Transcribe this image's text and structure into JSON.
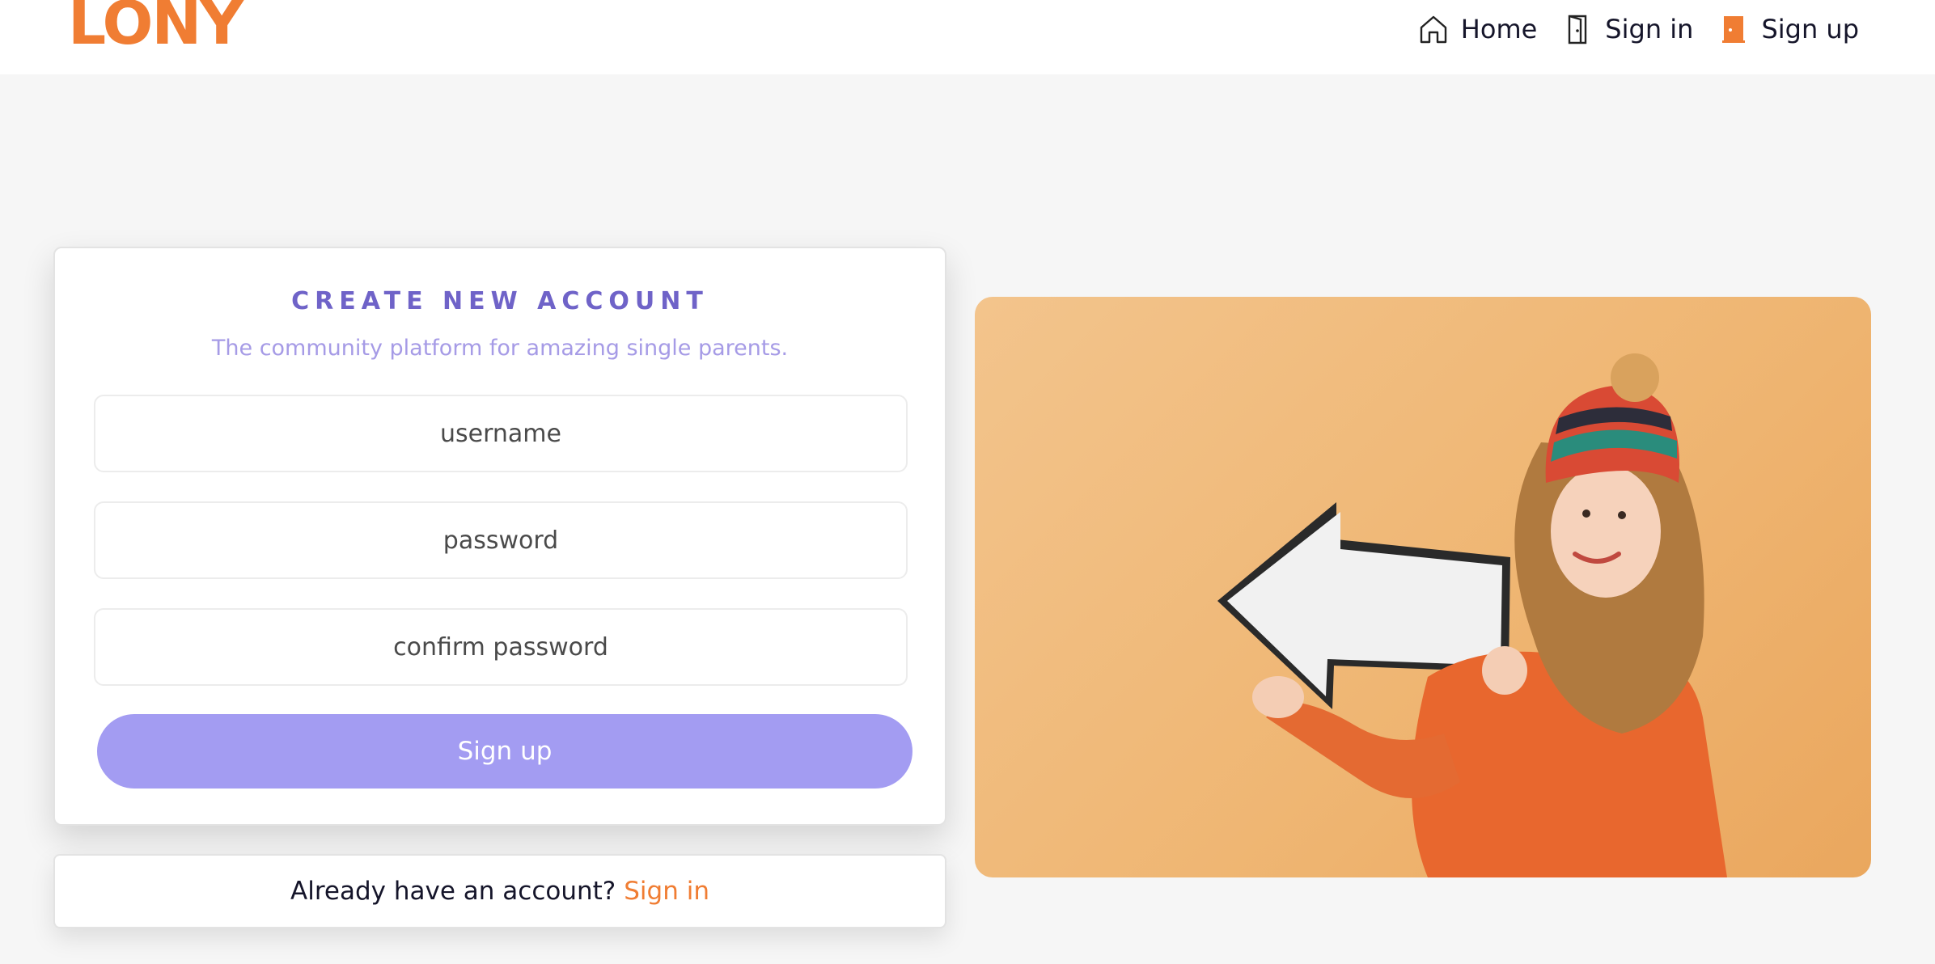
{
  "header": {
    "logo_text": "LONY",
    "nav": [
      {
        "label": "Home",
        "icon": "home-icon"
      },
      {
        "label": "Sign in",
        "icon": "door-icon"
      },
      {
        "label": "Sign up",
        "icon": "door-open-icon"
      }
    ]
  },
  "form": {
    "title": "CREATE NEW ACCOUNT",
    "subtitle": "The community platform for amazing single parents.",
    "username_placeholder": "username",
    "password_placeholder": "password",
    "confirm_placeholder": "confirm password",
    "submit_label": "Sign up"
  },
  "footer_card": {
    "prompt": "Already have an account?",
    "link_label": "Sign in"
  },
  "colors": {
    "brand_orange": "#f07d33",
    "accent_purple": "#a39cf2",
    "title_purple": "#6f63c8"
  }
}
